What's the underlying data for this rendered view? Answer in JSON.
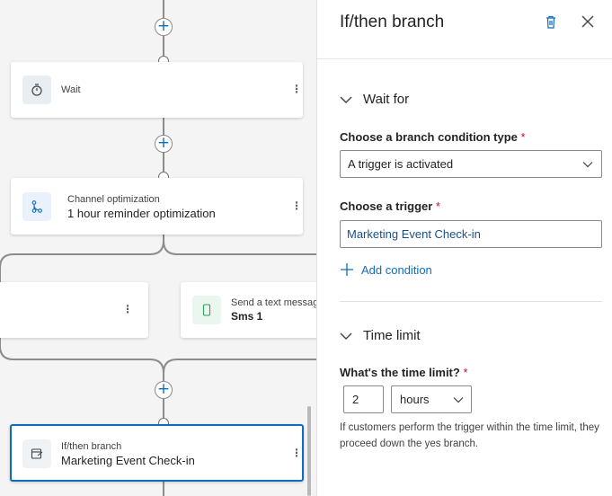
{
  "canvas": {
    "wait_card": {
      "label": "Wait",
      "icon": "timer-icon"
    },
    "channel_card": {
      "subtitle": "Channel optimization",
      "title": "1 hour reminder optimization",
      "icon": "branch-icon"
    },
    "sms_card": {
      "subtitle": "Send a text message",
      "title": "Sms 1",
      "icon": "phone-icon"
    },
    "branch_card": {
      "subtitle": "If/then branch",
      "title": "Marketing Event Check-in",
      "icon": "condition-icon"
    },
    "more_glyph": "⋮",
    "plus_glyph": "+"
  },
  "panel": {
    "title": "If/then branch",
    "wait_section": {
      "header": "Wait for",
      "condition_type_label": "Choose a branch condition type",
      "condition_type_value": "A trigger is activated",
      "trigger_label": "Choose a trigger",
      "trigger_value": "Marketing Event Check-in",
      "add_condition": "Add condition"
    },
    "time_section": {
      "header": "Time limit",
      "label": "What's the time limit?",
      "amount": "2",
      "unit": "hours",
      "help": "If customers perform the trigger within the time limit, they proceed down the yes branch."
    },
    "required_marker": "*"
  },
  "colors": {
    "accent": "#0f6cbd",
    "required": "#c50f1f",
    "canvas_bg": "#f4f4f4",
    "connector": "#8c8c8c"
  }
}
